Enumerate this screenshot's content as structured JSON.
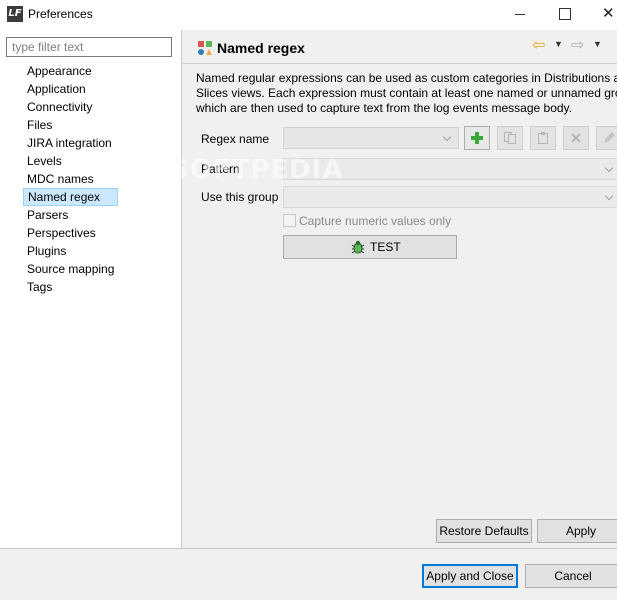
{
  "window": {
    "app_icon_text": "LF",
    "title": "Preferences"
  },
  "filter": {
    "placeholder": "type filter text"
  },
  "tree": {
    "items": [
      {
        "label": "Appearance"
      },
      {
        "label": "Application"
      },
      {
        "label": "Connectivity"
      },
      {
        "label": "Files"
      },
      {
        "label": "JIRA integration"
      },
      {
        "label": "Levels"
      },
      {
        "label": "MDC names"
      },
      {
        "label": "Named regex",
        "selected": true
      },
      {
        "label": "Parsers"
      },
      {
        "label": "Perspectives"
      },
      {
        "label": "Plugins"
      },
      {
        "label": "Source mapping"
      },
      {
        "label": "Tags"
      }
    ]
  },
  "page": {
    "title": "Named regex",
    "description_lines": [
      "Named regular expressions can be used as custom categories in Distributions and",
      "Slices views. Each expression must contain at least one named or unnamed group",
      "which are then used to capture text from the log events message body."
    ],
    "labels": {
      "regex_name": "Regex name",
      "pattern": "Pattern",
      "use_group": "Use this group"
    },
    "checkbox_label": "Capture numeric values only",
    "test_label": "TEST",
    "restore_defaults": "Restore Defaults",
    "apply": "Apply"
  },
  "footer": {
    "apply_and_close": "Apply and Close",
    "cancel": "Cancel"
  },
  "watermark": "SOFTPEDIA",
  "colors": {
    "selection_bg": "#cce8ff",
    "selection_border": "#99d1ff",
    "default_button_border": "#0078d7",
    "add_icon": "#3aa83a",
    "back_arrow": "#e6a817"
  }
}
